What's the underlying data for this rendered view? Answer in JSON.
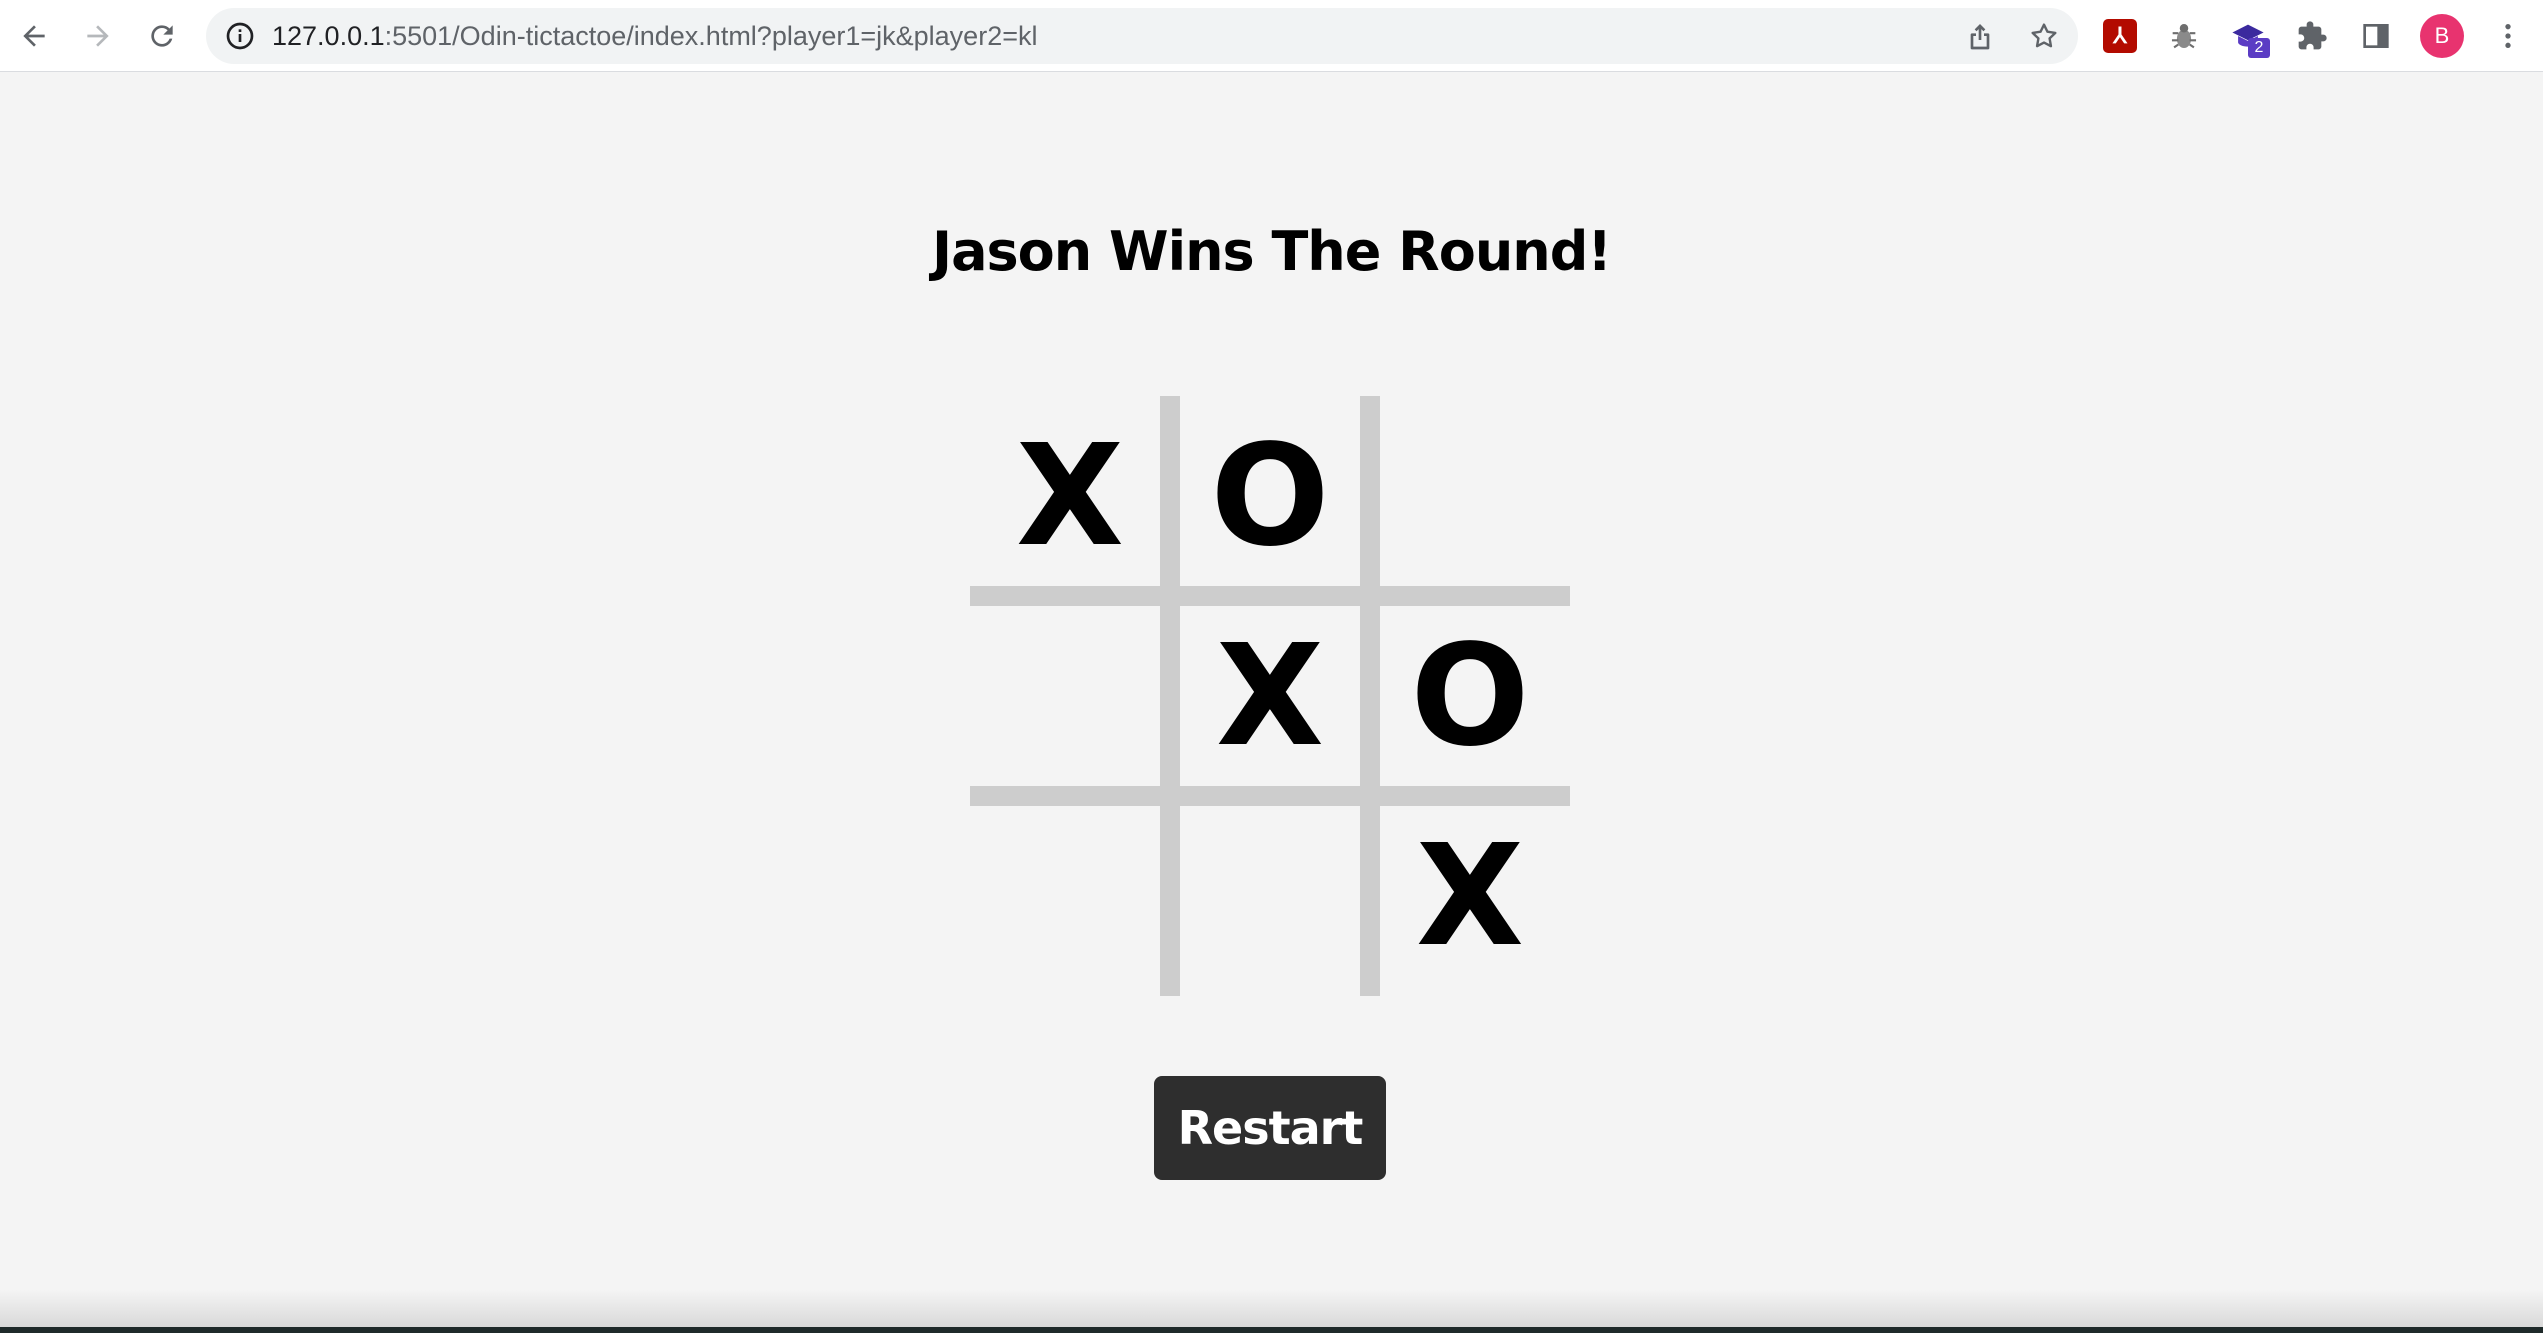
{
  "browser": {
    "url_host": "127.0.0.1",
    "url_rest": ":5501/Odin-tictactoe/index.html?player1=jk&player2=kl",
    "extensions": {
      "pdf_label": "⅄",
      "badge_count": "2"
    },
    "profile_initial": "B",
    "icons": [
      "back-arrow-icon",
      "forward-arrow-icon",
      "reload-icon",
      "info-icon",
      "share-icon",
      "bookmark-star-icon",
      "pdf-extension-icon",
      "bug-extension-icon",
      "graduation-cap-extension-icon",
      "puzzle-icon",
      "side-panel-icon",
      "kebab-menu-icon"
    ]
  },
  "game": {
    "status": "Jason Wins The Round!",
    "board": [
      [
        "X",
        "O",
        ""
      ],
      [
        "",
        "X",
        "O"
      ],
      [
        "",
        "",
        "X"
      ]
    ],
    "restart_label": "Restart",
    "colors": {
      "grid": "#cdcdcd",
      "button": "#2e2e2e",
      "background": "#f4f4f4"
    }
  }
}
